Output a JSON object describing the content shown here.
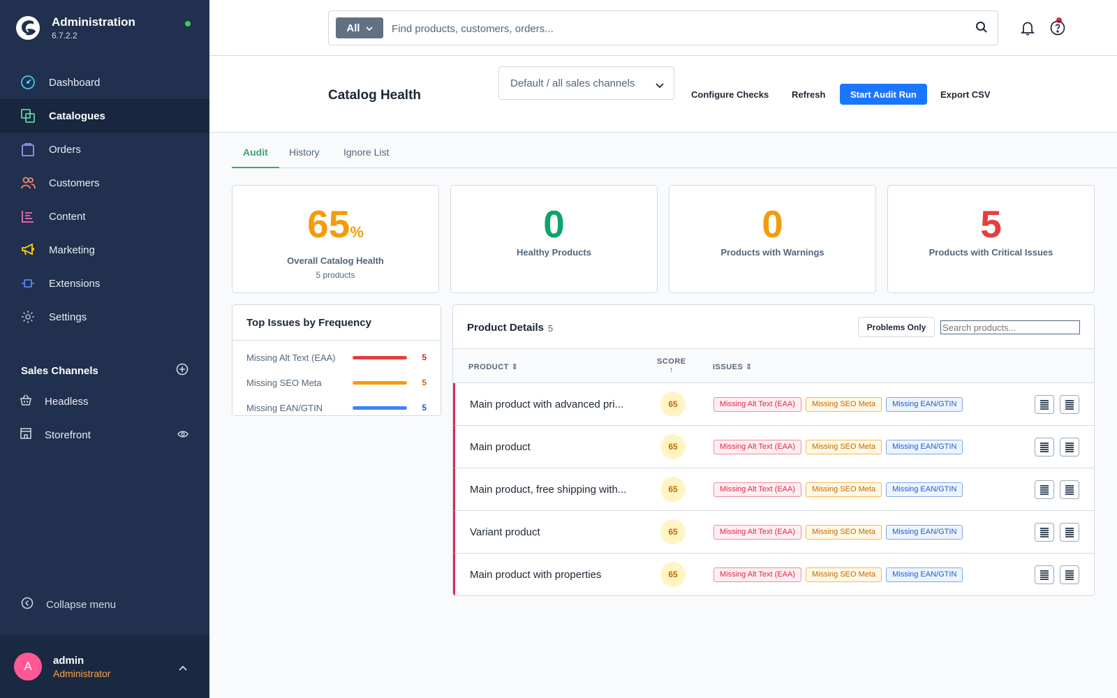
{
  "brand": {
    "title": "Administration",
    "version": "6.7.2.2"
  },
  "nav": [
    {
      "label": "Dashboard",
      "icon": "dashboard-icon",
      "color": "#3fcaeb"
    },
    {
      "label": "Catalogues",
      "icon": "catalogue-icon",
      "color": "#57d9a3"
    },
    {
      "label": "Orders",
      "icon": "orders-icon",
      "color": "#a092f0"
    },
    {
      "label": "Customers",
      "icon": "customers-icon",
      "color": "#f88962"
    },
    {
      "label": "Content",
      "icon": "content-icon",
      "color": "#ff68b4"
    },
    {
      "label": "Marketing",
      "icon": "marketing-icon",
      "color": "#ffd700"
    },
    {
      "label": "Extensions",
      "icon": "extensions-icon",
      "color": "#5785f5"
    },
    {
      "label": "Settings",
      "icon": "settings-icon",
      "color": "#9aa8b5"
    }
  ],
  "sales_channels": {
    "title": "Sales Channels",
    "items": [
      {
        "label": "Headless",
        "icon": "basket-icon"
      },
      {
        "label": "Storefront",
        "icon": "storefront-icon"
      }
    ]
  },
  "collapse_label": "Collapse menu",
  "user": {
    "initial": "A",
    "name": "admin",
    "role": "Administrator"
  },
  "search": {
    "type": "All",
    "placeholder": "Find products, customers, orders..."
  },
  "page": {
    "title": "Catalog Health",
    "channel": "Default / all sales channels",
    "buttons": {
      "configure": "Configure Checks",
      "refresh": "Refresh",
      "start": "Start Audit Run",
      "export": "Export CSV"
    }
  },
  "tabs": [
    "Audit",
    "History",
    "Ignore List"
  ],
  "stats": [
    {
      "value": "65",
      "unit": "%",
      "label": "Overall Catalog Health",
      "sub": "5 products",
      "color": "#f59c0b"
    },
    {
      "value": "0",
      "unit": "",
      "label": "Healthy Products",
      "sub": "",
      "color": "#0fa36b"
    },
    {
      "value": "0",
      "unit": "",
      "label": "Products with Warnings",
      "sub": "",
      "color": "#f59c0b"
    },
    {
      "value": "5",
      "unit": "",
      "label": "Products with Critical Issues",
      "sub": "",
      "color": "#e53e3e"
    }
  ],
  "top_issues": {
    "title": "Top Issues by Frequency",
    "items": [
      {
        "label": "Missing Alt Text (EAA)",
        "count": "5",
        "color": "#e53e3e",
        "count_color": "#c53030"
      },
      {
        "label": "Missing SEO Meta",
        "count": "5",
        "color": "#f59c0b",
        "count_color": "#c36a00"
      },
      {
        "label": "Missing EAN/GTIN",
        "count": "5",
        "color": "#3b82f6",
        "count_color": "#1a5fcf"
      }
    ]
  },
  "details": {
    "title": "Product Details",
    "count": "5",
    "problems_label": "Problems Only",
    "search_placeholder": "Search products...",
    "columns": {
      "product": "PRODUCT",
      "score": "SCORE",
      "issues": "ISSUES"
    },
    "rows": [
      {
        "name": "Main product with advanced pri...",
        "score": "65"
      },
      {
        "name": "Main product",
        "score": "65"
      },
      {
        "name": "Main product, free shipping with...",
        "score": "65"
      },
      {
        "name": "Variant product",
        "score": "65"
      },
      {
        "name": "Main product with properties",
        "score": "65"
      }
    ],
    "tags": [
      {
        "label": "Missing Alt Text (EAA)",
        "tone": "red"
      },
      {
        "label": "Missing SEO Meta",
        "tone": "orange"
      },
      {
        "label": "Missing EAN/GTIN",
        "tone": "blue"
      }
    ]
  }
}
